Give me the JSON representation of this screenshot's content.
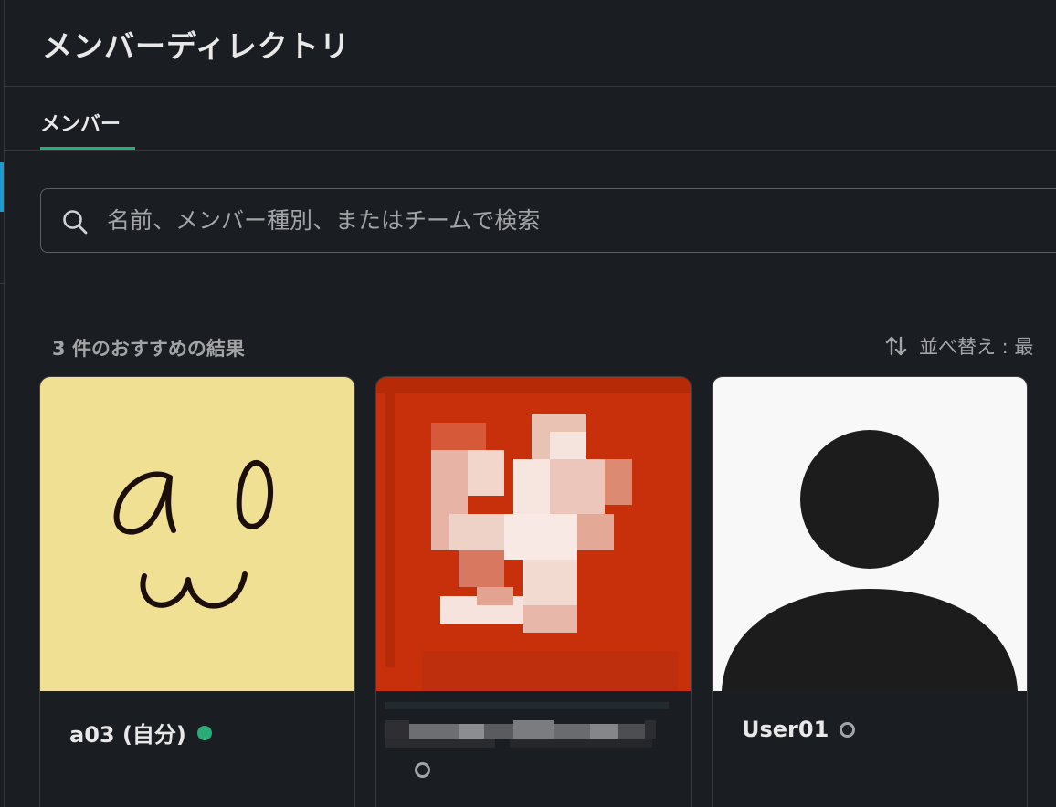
{
  "header": {
    "title": "メンバーディレクトリ"
  },
  "tabs": [
    {
      "label": "メンバー",
      "active": true
    }
  ],
  "search": {
    "placeholder": "名前、メンバー種別、またはチームで検索",
    "value": ""
  },
  "results": {
    "count_label": "3 件のおすすめの結果",
    "sort_label": "並べ替え : 最"
  },
  "members": [
    {
      "name": "a03 (自分)",
      "presence": "active",
      "avatar": "handwritten-note"
    },
    {
      "name": "",
      "presence": "away",
      "avatar": "pixelated-image"
    },
    {
      "name": "User01",
      "presence": "away",
      "avatar": "default-silhouette"
    }
  ],
  "colors": {
    "background": "#1a1d21",
    "accent_tab": "#2bac76",
    "presence_active": "#2bac76",
    "rail_accent": "#1d9bd1",
    "avatar_note": "#f3e49a",
    "avatar_red": "#c8300b"
  },
  "icons": {
    "search": "search-icon",
    "sort": "sort-arrows-icon",
    "presence": "status-dot-icon"
  }
}
